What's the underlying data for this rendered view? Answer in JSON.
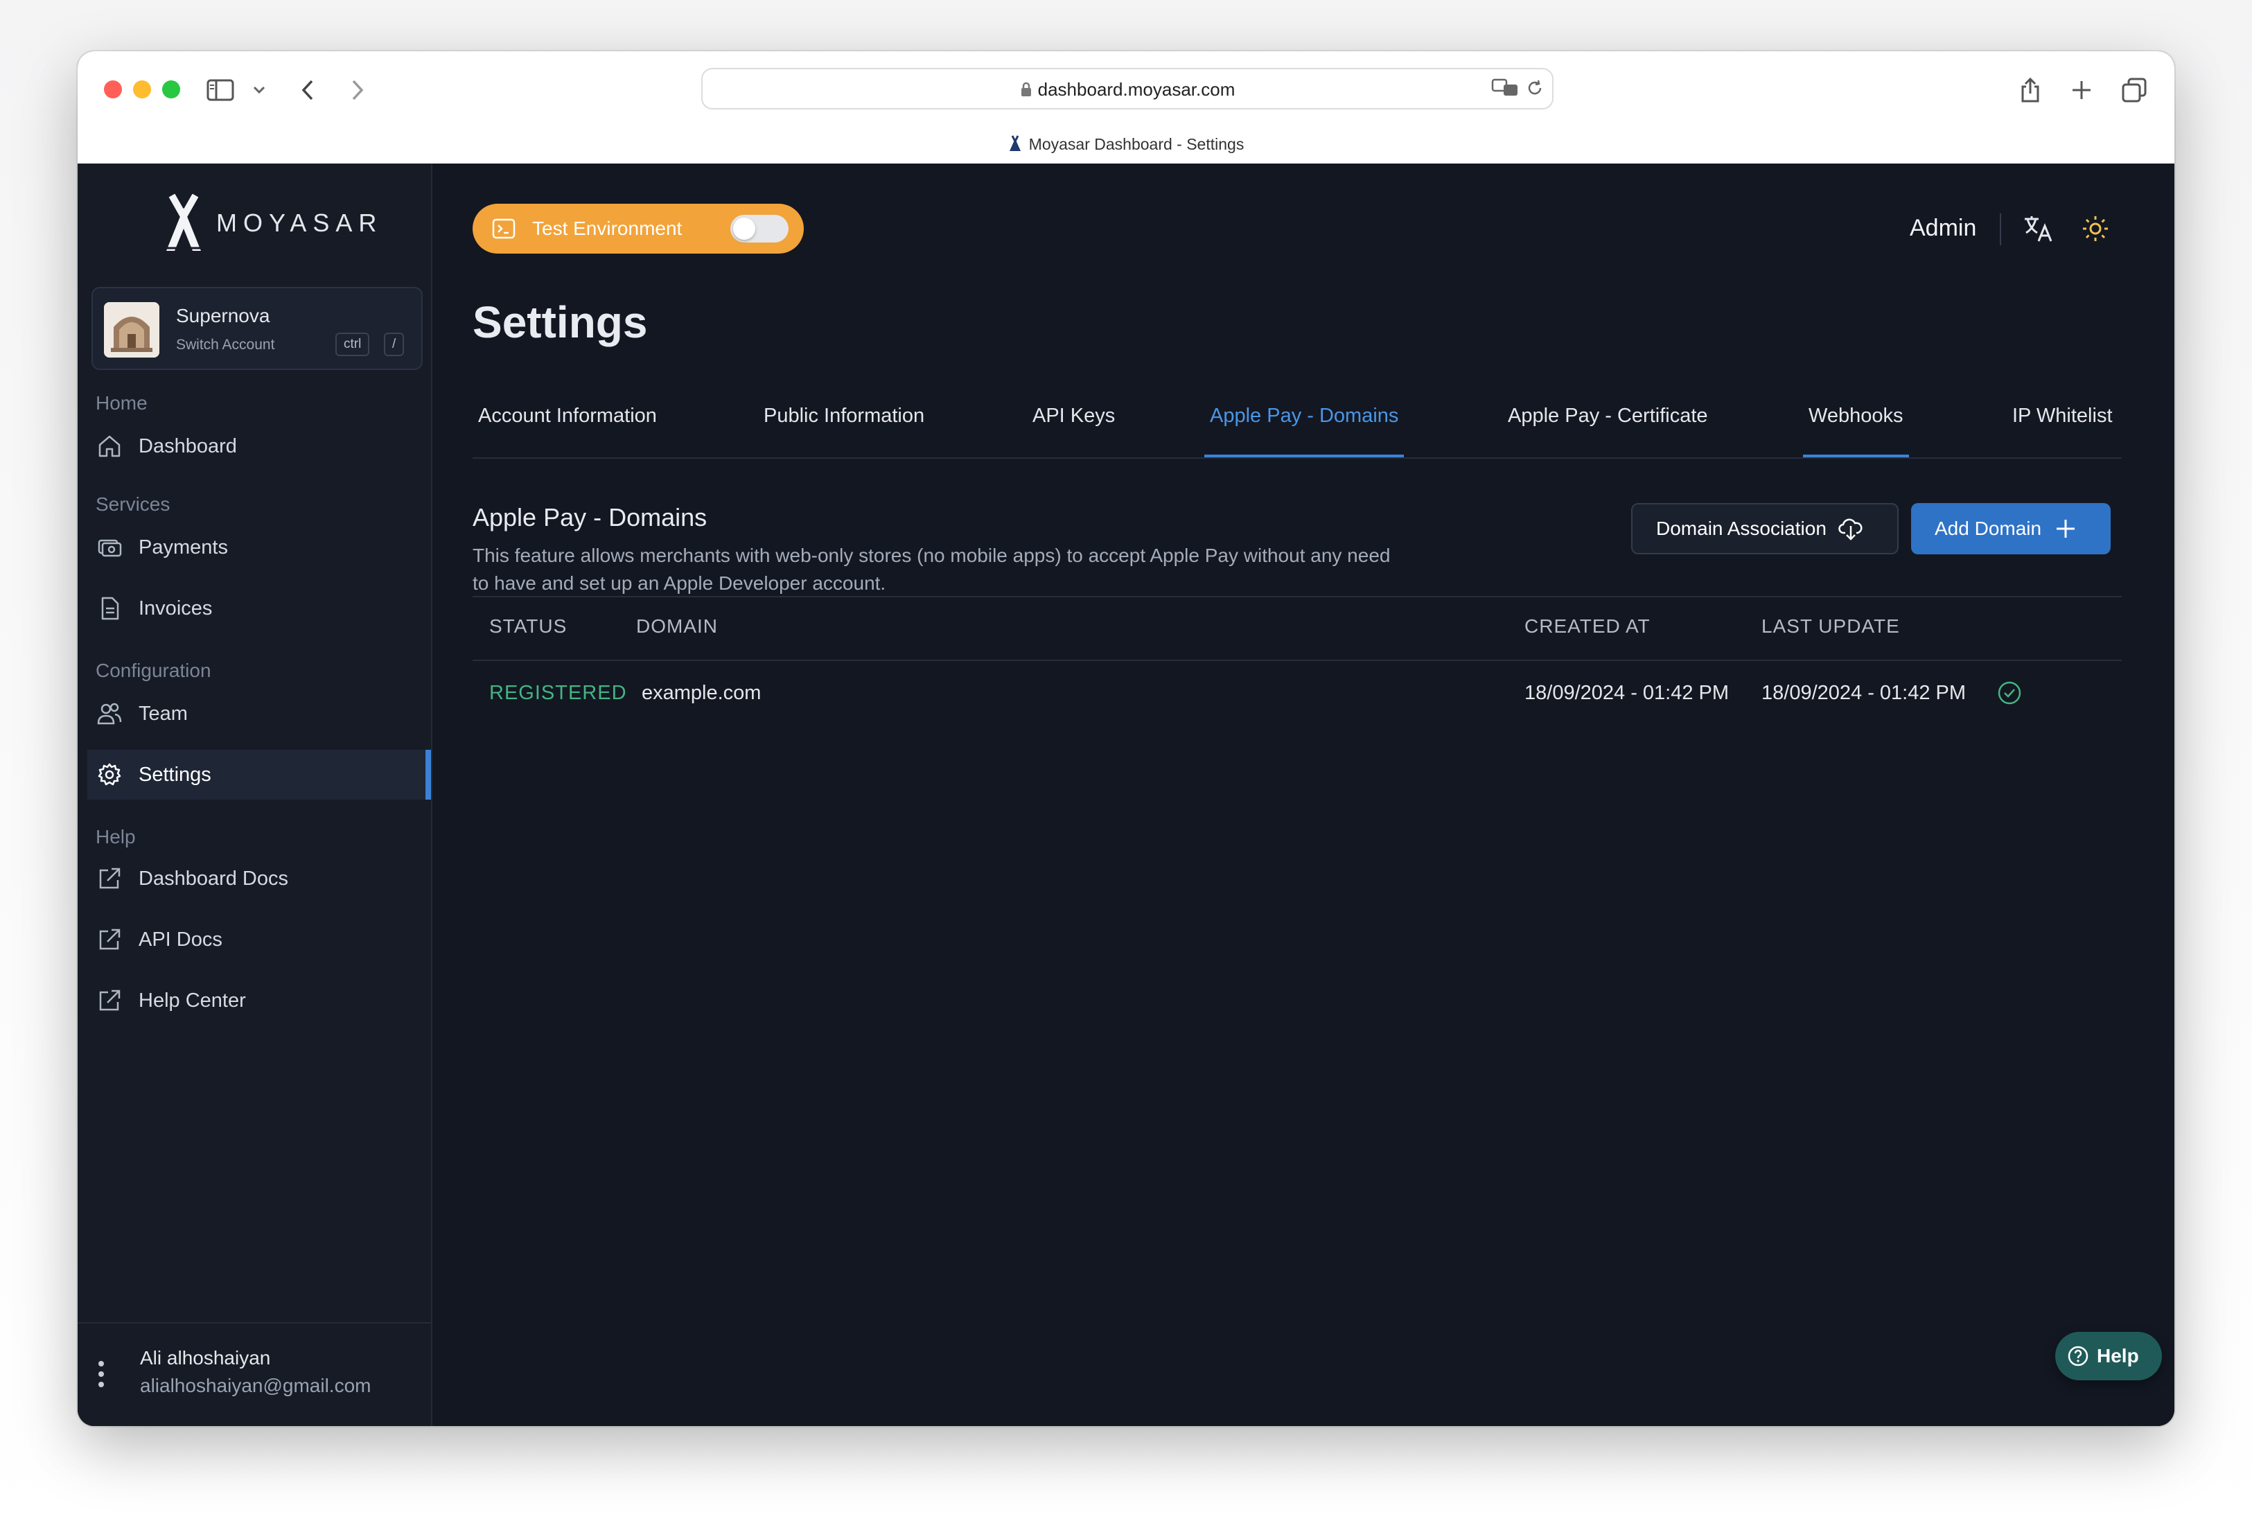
{
  "browser": {
    "url": "dashboard.moyasar.com",
    "tab_title": "Moyasar Dashboard - Settings"
  },
  "brand": {
    "name": "MOYASAR",
    "accent": "#3b82d6",
    "test_color": "#f2a33a"
  },
  "account": {
    "name": "Supernova",
    "switch_label": "Switch Account",
    "shortcut_key1": "ctrl",
    "shortcut_key2": "/"
  },
  "sidebar": {
    "sections": {
      "home": "Home",
      "services": "Services",
      "configuration": "Configuration",
      "help": "Help"
    },
    "items": [
      {
        "label": "Dashboard",
        "icon": "home-icon"
      },
      {
        "label": "Payments",
        "icon": "payments-icon"
      },
      {
        "label": "Invoices",
        "icon": "invoice-icon"
      },
      {
        "label": "Team",
        "icon": "team-icon"
      },
      {
        "label": "Settings",
        "icon": "gear-icon",
        "active": true
      },
      {
        "label": "Dashboard Docs",
        "icon": "external-link-icon"
      },
      {
        "label": "API Docs",
        "icon": "external-link-icon"
      },
      {
        "label": "Help Center",
        "icon": "external-link-icon"
      }
    ]
  },
  "user": {
    "name": "Ali alhoshaiyan",
    "email": "alialhoshaiyan@gmail.com"
  },
  "header": {
    "test_env_label": "Test Environment",
    "test_env_enabled": false,
    "admin_label": "Admin"
  },
  "page": {
    "title": "Settings"
  },
  "tabs": [
    {
      "label": "Account Information"
    },
    {
      "label": "Public Information"
    },
    {
      "label": "API Keys"
    },
    {
      "label": "Apple Pay - Domains",
      "active": true
    },
    {
      "label": "Apple Pay - Certificate"
    },
    {
      "label": "Webhooks"
    },
    {
      "label": "IP Whitelist"
    }
  ],
  "section": {
    "title": "Apple Pay - Domains",
    "description": "This feature allows merchants with web-only stores (no mobile apps) to accept Apple Pay without any need to have and set up an Apple Developer account.",
    "domain_association_label": "Domain Association",
    "add_domain_label": "Add Domain"
  },
  "table": {
    "columns": [
      "STATUS",
      "DOMAIN",
      "CREATED AT",
      "LAST UPDATE"
    ],
    "rows": [
      {
        "status": "REGISTERED",
        "domain": "example.com",
        "created_at": "18/09/2024 - 01:42 PM",
        "last_update": "18/09/2024 - 01:42 PM"
      }
    ]
  },
  "help_button": {
    "label": "Help"
  }
}
